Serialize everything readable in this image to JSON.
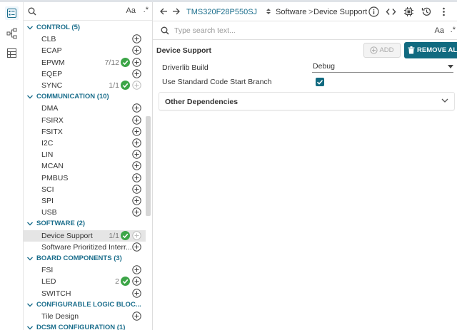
{
  "sidebar": {
    "search": {
      "placeholder": "",
      "case_label": "Aa",
      "regex_label": ".*"
    },
    "categories": [
      {
        "label": "CONTROL (5)",
        "modules": [
          {
            "label": "CLB",
            "count": "",
            "checked": false
          },
          {
            "label": "ECAP",
            "count": "",
            "checked": false
          },
          {
            "label": "EPWM",
            "count": "7/12",
            "checked": true
          },
          {
            "label": "EQEP",
            "count": "",
            "checked": false
          },
          {
            "label": "SYNC",
            "count": "1/1",
            "checked": true
          }
        ]
      },
      {
        "label": "COMMUNICATION (10)",
        "modules": [
          {
            "label": "DMA"
          },
          {
            "label": "FSIRX"
          },
          {
            "label": "FSITX"
          },
          {
            "label": "I2C"
          },
          {
            "label": "LIN"
          },
          {
            "label": "MCAN"
          },
          {
            "label": "PMBUS"
          },
          {
            "label": "SCI"
          },
          {
            "label": "SPI"
          },
          {
            "label": "USB"
          }
        ]
      },
      {
        "label": "SOFTWARE (2)",
        "modules": [
          {
            "label": "Device Support",
            "count": "1/1",
            "checked": true,
            "selected": true
          },
          {
            "label": "Software Prioritized Interr..."
          }
        ]
      },
      {
        "label": "BOARD COMPONENTS (3)",
        "modules": [
          {
            "label": "FSI"
          },
          {
            "label": "LED",
            "count": "2",
            "checked": true
          },
          {
            "label": "SWITCH"
          }
        ]
      },
      {
        "label": "CONFIGURABLE LOGIC BLOC...",
        "modules": [
          {
            "label": "Tile Design"
          }
        ]
      },
      {
        "label": "DCSM CONFIGURATION (1)",
        "modules": []
      }
    ]
  },
  "topbar": {
    "device": "TMS320F28P550SJ",
    "crumb_software": "Software",
    "crumb_sep": ">",
    "crumb_module": "Device Support",
    "icons": [
      "info-icon",
      "code-icon",
      "chip-icon",
      "history-icon",
      "more-vertical-icon"
    ]
  },
  "content": {
    "search_placeholder": "Type search text...",
    "case_label": "Aa",
    "regex_label": ".*",
    "module_title": "Device Support",
    "add_label": "ADD",
    "remove_label": "REMOVE ALL",
    "driverlib_label": "Driverlib Build",
    "driverlib_value": "Debug",
    "start_branch_label": "Use Standard Code Start Branch",
    "start_branch_checked": true,
    "other_deps_label": "Other Dependencies"
  },
  "colors": {
    "accent": "#116a80",
    "category": "#1b6e8c",
    "check": "#3ca547"
  }
}
